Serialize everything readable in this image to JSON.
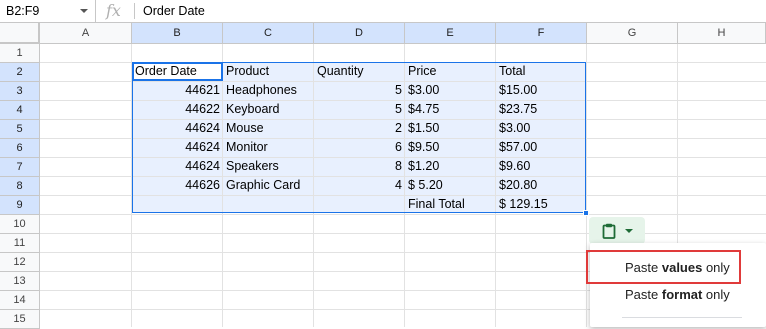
{
  "name_box": "B2:F9",
  "fx_label": "fx",
  "formula_value": "Order Date",
  "columns": [
    "A",
    "B",
    "C",
    "D",
    "E",
    "F",
    "G",
    "H"
  ],
  "rows": [
    "1",
    "2",
    "3",
    "4",
    "5",
    "6",
    "7",
    "8",
    "9",
    "10",
    "11",
    "12",
    "13",
    "14",
    "15"
  ],
  "table": {
    "headers": [
      "Order Date",
      "Product",
      "Quantity",
      "Price",
      "Total"
    ],
    "rows": [
      [
        "44621",
        "Headphones",
        "5",
        "$3.00",
        "$15.00"
      ],
      [
        "44622",
        "Keyboard",
        "5",
        "$4.75",
        "$23.75"
      ],
      [
        "44624",
        "Mouse",
        "2",
        "$1.50",
        "$3.00"
      ],
      [
        "44624",
        "Monitor",
        "6",
        "$9.50",
        "$57.00"
      ],
      [
        "44624",
        "Speakers",
        "8",
        "$1.20",
        "$9.60"
      ],
      [
        "44626",
        "Graphic Card",
        "4",
        "$ 5.20",
        "$20.80"
      ]
    ],
    "final_label": "Final Total",
    "final_value": "$ 129.15"
  },
  "paste_menu": {
    "values": {
      "prefix": "Paste ",
      "bold": "values",
      "suffix": " only"
    },
    "format": {
      "prefix": "Paste ",
      "bold": "format",
      "suffix": " only"
    }
  },
  "colors": {
    "selection_fill": "#e8f0fe",
    "selection_border": "#1a73e8",
    "paste_button_bg": "#e6f4ea",
    "highlight_border": "#e03a3a"
  }
}
